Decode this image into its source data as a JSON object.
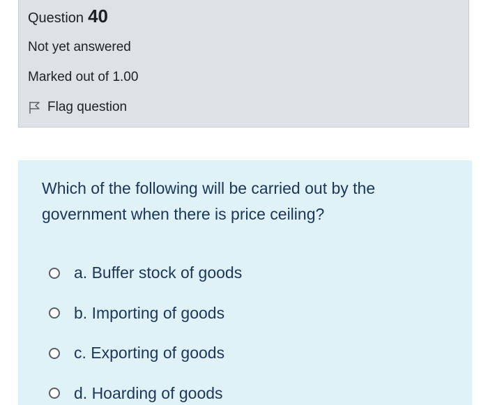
{
  "question_info": {
    "label": "Question",
    "number": "40",
    "state": "Not yet answered",
    "grade": "Marked out of 1.00",
    "flag_label": "Flag question"
  },
  "question": {
    "text": "Which of the following will be carried out by the government when there is price ceiling?",
    "answers": [
      {
        "label": "a. Buffer stock of goods",
        "selected": false
      },
      {
        "label": "b. Importing of goods",
        "selected": false
      },
      {
        "label": "c. Exporting of goods",
        "selected": false
      },
      {
        "label": "d. Hoarding of goods",
        "selected": false
      }
    ]
  },
  "colors": {
    "info_background": "#dee2e6",
    "content_background": "#def2f8",
    "text": "#1d2125",
    "question_text": "#1d3557"
  }
}
